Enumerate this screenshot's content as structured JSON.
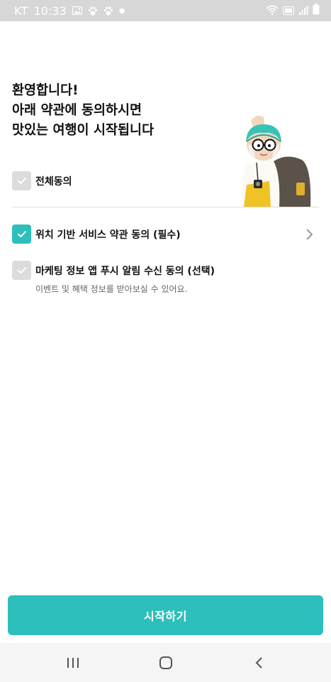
{
  "status_bar": {
    "carrier": "KT",
    "time": "10:33",
    "left_icons": [
      "image-icon",
      "paw-icon",
      "paw-icon",
      "dot-icon"
    ],
    "right_icons": [
      "wifi-icon",
      "volte-icon",
      "signal-icon",
      "battery-icon"
    ]
  },
  "welcome": {
    "line1": "환영합니다!",
    "line2": "아래 약관에 동의하시면",
    "line3": "맛있는 여행이 시작됩니다"
  },
  "agreements": {
    "all": {
      "label": "전체동의",
      "checked": false
    },
    "location": {
      "label": "위치 기반 서비스 약관 동의 (필수)",
      "checked": true
    },
    "marketing": {
      "label": "마케팅 정보 앱 푸시 알림 수신 동의 (선택)",
      "description": "이벤트 및 혜택 정보를 받아보실 수 있어요.",
      "checked": false
    }
  },
  "start_button": {
    "label": "시작하기"
  },
  "colors": {
    "accent": "#2dbfbb",
    "checkbox_off": "#dcdcdc",
    "status_bar": "#d7d7d7"
  },
  "nav_bar": {
    "icons": [
      "recents-icon",
      "home-icon",
      "back-icon"
    ]
  }
}
